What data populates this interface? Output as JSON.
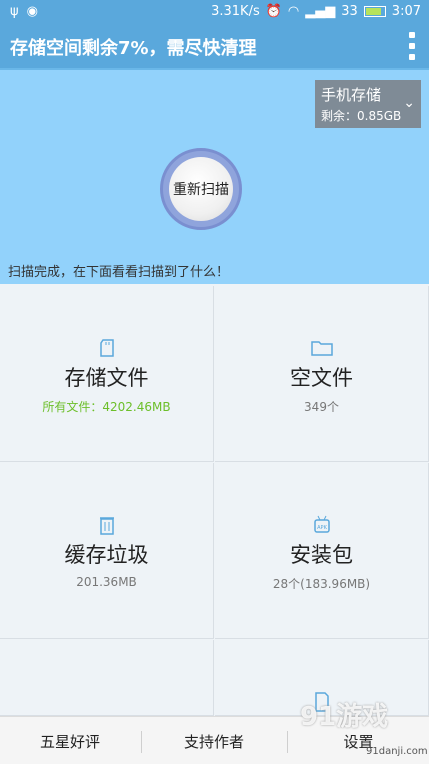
{
  "status_bar": {
    "speed": "3.31K/s",
    "signal": "33",
    "time": "3:07"
  },
  "header": {
    "title": "存储空间剩余7%，需尽快清理"
  },
  "storage_selector": {
    "title": "手机存储",
    "remaining": "剩余：0.85GB"
  },
  "scan": {
    "button_label": "重新扫描",
    "message": "扫描完成，在下面看看扫描到了什么！"
  },
  "cells": [
    {
      "label": "存储文件",
      "sub": "所有文件：4202.46MB"
    },
    {
      "label": "空文件",
      "sub": "349个"
    },
    {
      "label": "缓存垃圾",
      "sub": "201.36MB"
    },
    {
      "label": "安装包",
      "sub": "28个(183.96MB)"
    }
  ],
  "bottom": {
    "rate": "五星好评",
    "support": "支持作者",
    "settings": "设置"
  },
  "watermark": {
    "brand": "91游戏",
    "domain": "91danji.com"
  },
  "colors": {
    "primary": "#5aa8dc",
    "panel": "#92d2fb",
    "accent_green": "#6cbf2a"
  }
}
